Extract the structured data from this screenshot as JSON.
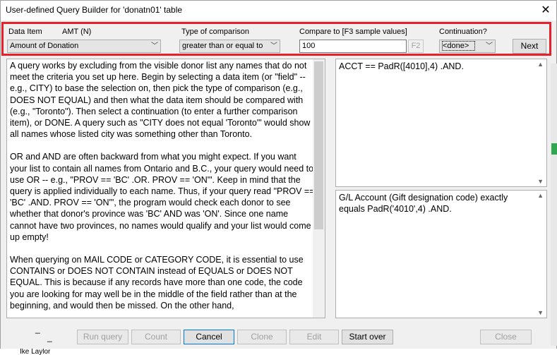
{
  "window": {
    "title": "User-defined Query Builder for 'donatn01' table",
    "close_glyph": "✕"
  },
  "query_row": {
    "data_item_label": "Data Item",
    "data_item_hint": "AMT  (N)",
    "data_item_value": "Amount of Donation",
    "comparison_label": "Type of comparison",
    "comparison_value": "greater than or equal to",
    "compare_to_label": "Compare to  [F3 sample values]",
    "compare_to_value": "100",
    "f2_label": "F2",
    "continuation_label": "Continuation?",
    "continuation_value": "<done>",
    "next_label": "Next"
  },
  "help_text": [
    "A query works by excluding from the visible donor list any names that do not meet the criteria you set up here.  Begin by selecting a data item (or \"field\" -- e.g., CITY) to base the selection on, then pick the type of comparison (e.g., DOES NOT EQUAL) and then what the data item should be compared with (e.g., \"Toronto\").  Then select a continuation (to enter a further comparison item), or DONE.  A query such as \"CITY does not equal 'Toronto'\" would show all names whose listed city was something other than Toronto.",
    "OR and AND are often backward from what you might expect. If you want your list to contain all names from Ontario and B.C., your query would need to use OR -- e.g., \"PROV == 'BC' .OR. PROV == 'ON'\".  Keep in mind that the query is applied individually to each name.  Thus, if your query read \"PROV == 'BC' .AND. PROV == 'ON'\", the program would check each donor to see whether that donor's province was 'BC' AND was 'ON'.  Since one name cannot have two provinces, no names would qualify and your list would come up empty!",
    "When querying on MAIL CODE or CATEGORY CODE, it is essential to use CONTAINS or DOES NOT CONTAIN instead of EQUALS or DOES NOT EQUAL. This is because if any records have more than one code, the code you are looking for may well be in the middle of the field rather than at the beginning, and would then be missed. On the other hand,"
  ],
  "query_expression": "ACCT == PadR([4010],4) .AND.",
  "query_description": "G/L Account (Gift designation code) exactly equals PadR('4010',4) .AND.",
  "buttons": {
    "run_query": "Run query",
    "count": "Count",
    "cancel": "Cancel",
    "clone": "Clone",
    "edit": "Edit",
    "start_over": "Start over",
    "close": "Close"
  },
  "background": {
    "behind_text": "Ike  Laylor"
  }
}
